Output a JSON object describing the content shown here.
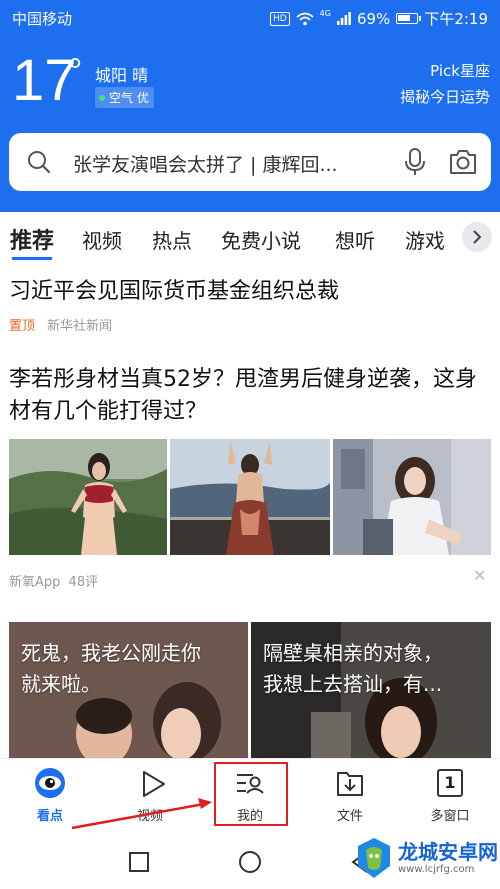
{
  "statusbar": {
    "carrier": "中国移动",
    "hd": "HD",
    "signal": "4G",
    "battery": "69%",
    "time": "下午2:19",
    "battery_level": 0.69
  },
  "weather": {
    "temperature": "17",
    "degree": "°",
    "city_weather": "城阳 晴",
    "aqi": "空气 优",
    "pick_label": "Pick星座",
    "fortune_label": "揭秘今日运势"
  },
  "search": {
    "text": "张学友演唱会太拼了 | 康辉回..."
  },
  "tabs": [
    {
      "label": "推荐",
      "active": true
    },
    {
      "label": "视频"
    },
    {
      "label": "热点"
    },
    {
      "label": "免费小说"
    },
    {
      "label": "想听"
    },
    {
      "label": "游戏"
    }
  ],
  "news": [
    {
      "title": "习近平会见国际货币基金组织总裁",
      "tag": "置顶",
      "source": "新华社新闻"
    },
    {
      "title": "李若彤身材当真52岁？甩渣男后健身逆袭，这身材有几个能打得过？",
      "source": "新氧App",
      "comments": "48评"
    }
  ],
  "cards": [
    {
      "line1": "死鬼，我老公刚走你",
      "line2": "就来啦。"
    },
    {
      "line1": "隔壁桌相亲的对象，",
      "line2": "我想上去搭讪，有..."
    }
  ],
  "bottom_nav": [
    {
      "label": "看点",
      "icon": "eye-icon",
      "active": true
    },
    {
      "label": "视频",
      "icon": "play-icon"
    },
    {
      "label": "我的",
      "icon": "profile-list-icon"
    },
    {
      "label": "文件",
      "icon": "download-icon"
    },
    {
      "label": "多窗口",
      "icon": "window-count-icon",
      "count": "1"
    }
  ],
  "watermark": {
    "title": "龙城安卓网",
    "url": "www.lcjrfg.com"
  },
  "colors": {
    "brand_blue": "#1e6ef0",
    "pin_orange": "#f26522",
    "highlight_red": "#e02020"
  }
}
